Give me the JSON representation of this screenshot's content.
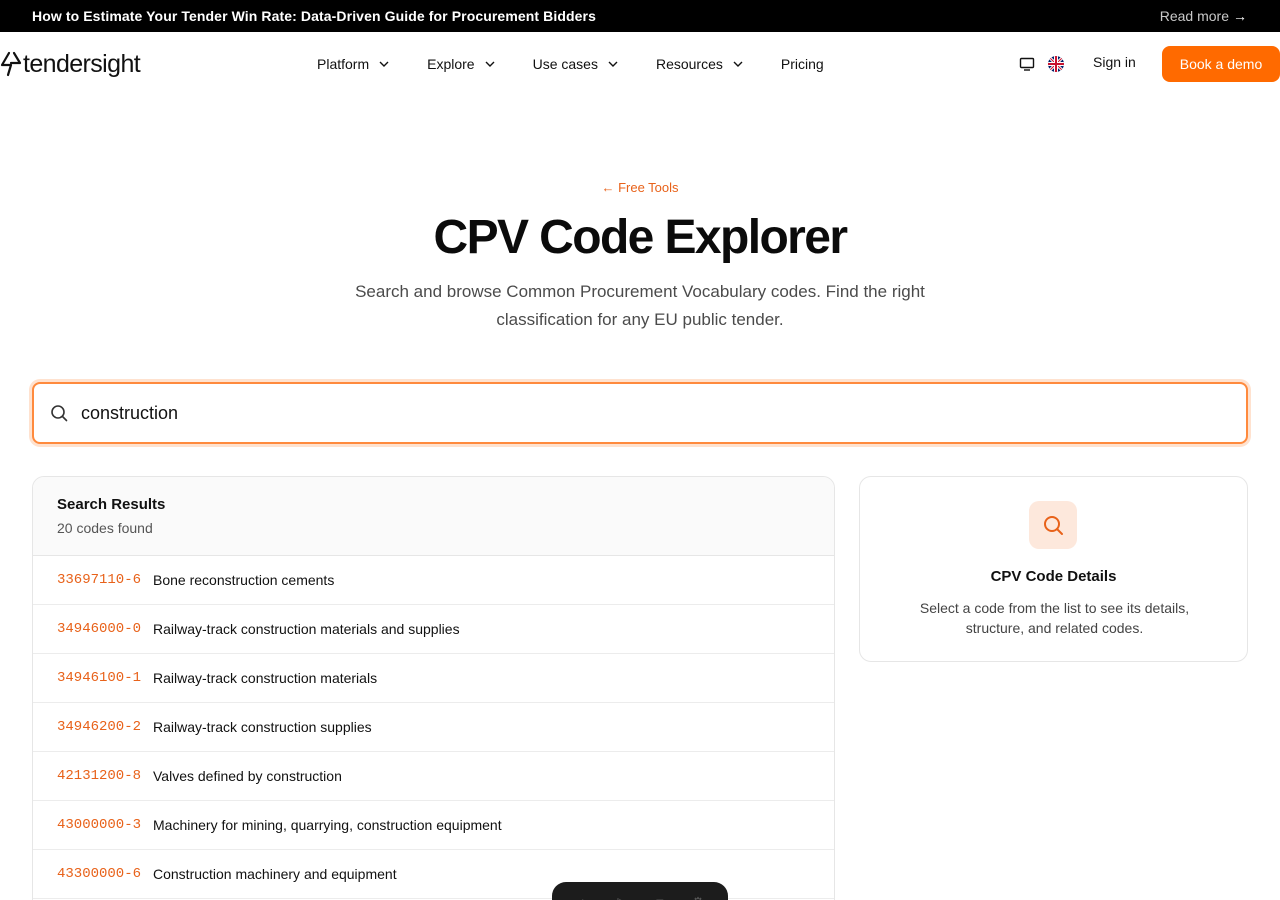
{
  "announcement": {
    "text": "How to Estimate Your Tender Win Rate: Data-Driven Guide for Procurement Bidders",
    "link_label": "Read more",
    "link_arrow": "→"
  },
  "nav": {
    "logo_text": "tendersight",
    "menu": [
      {
        "label": "Platform",
        "has_dropdown": true
      },
      {
        "label": "Explore",
        "has_dropdown": true
      },
      {
        "label": "Use cases",
        "has_dropdown": true
      },
      {
        "label": "Resources",
        "has_dropdown": true
      },
      {
        "label": "Pricing",
        "has_dropdown": false
      }
    ],
    "signin_label": "Sign in",
    "demo_label": "Book a demo"
  },
  "hero": {
    "back_link": "← Free Tools",
    "title": "CPV Code Explorer",
    "subtitle": "Search and browse Common Procurement Vocabulary codes. Find the right classification for any EU public tender."
  },
  "search": {
    "value": "construction"
  },
  "results": {
    "title": "Search Results",
    "count_text": "20 codes found",
    "rows": [
      {
        "code": "33697110-6",
        "desc": "Bone reconstruction cements"
      },
      {
        "code": "34946000-0",
        "desc": "Railway-track construction materials and supplies"
      },
      {
        "code": "34946100-1",
        "desc": "Railway-track construction materials"
      },
      {
        "code": "34946200-2",
        "desc": "Railway-track construction supplies"
      },
      {
        "code": "42131200-8",
        "desc": "Valves defined by construction"
      },
      {
        "code": "43000000-3",
        "desc": "Machinery for mining, quarrying, construction equipment"
      },
      {
        "code": "43300000-6",
        "desc": "Construction machinery and equipment"
      }
    ]
  },
  "details": {
    "title": "CPV Code Details",
    "text": "Select a code from the list to see its details, structure, and related codes."
  },
  "colors": {
    "accent": "#ff6a00",
    "code_text": "#e8621a",
    "announcement_bg": "#000000"
  }
}
